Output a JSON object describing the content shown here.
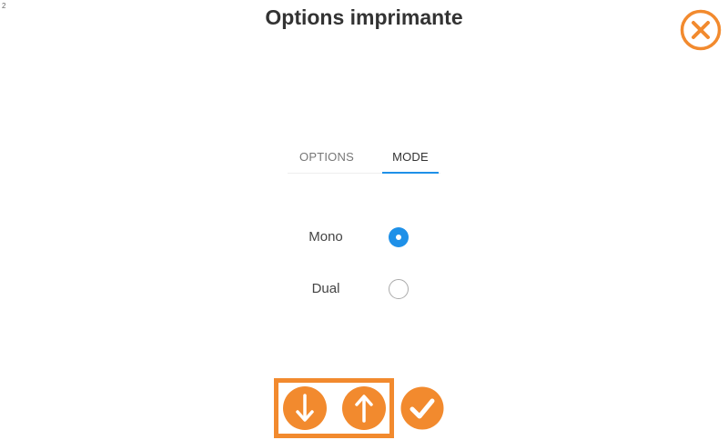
{
  "corner_label": "2",
  "title": "Options imprimante",
  "close_icon": "close-x-circle-icon",
  "tabs": [
    {
      "label": "OPTIONS",
      "active": false
    },
    {
      "label": "MODE",
      "active": true
    }
  ],
  "mode_options": [
    {
      "label": "Mono",
      "checked": true
    },
    {
      "label": "Dual",
      "checked": false
    }
  ],
  "bottom_buttons": {
    "down_icon": "arrow-down-icon",
    "up_icon": "arrow-up-icon",
    "confirm_icon": "checkmark-icon"
  },
  "colors": {
    "accent_orange": "#f28a2e",
    "radio_blue": "#1e90e8",
    "title_text": "#333333"
  }
}
